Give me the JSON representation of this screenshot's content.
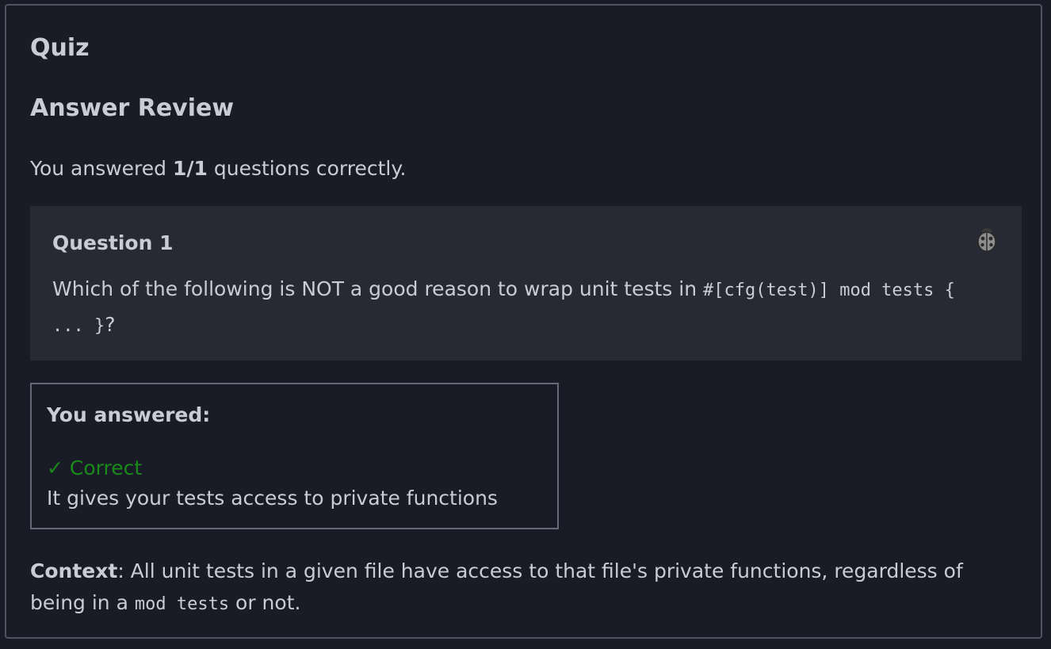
{
  "quiz": {
    "title": "Quiz",
    "review_heading": "Answer Review",
    "score": {
      "prefix": "You answered ",
      "value": "1/1",
      "suffix": " questions correctly."
    }
  },
  "question": {
    "label": "Question 1",
    "text_before": "Which of the following is NOT a good reason to wrap unit tests in ",
    "code": "#[cfg(test)] mod tests { ... }",
    "text_after": "?",
    "report_icon": "bug-icon"
  },
  "answer": {
    "heading": "You answered:",
    "status_mark": "✓",
    "status_label": "Correct",
    "status_color": "#1a8a1a",
    "text": "It gives your tests access to private functions"
  },
  "context": {
    "label": "Context",
    "text_before": ": All unit tests in a given file have access to that file's private functions, regardless of being in a ",
    "code": "mod tests",
    "text_after": " or not."
  }
}
